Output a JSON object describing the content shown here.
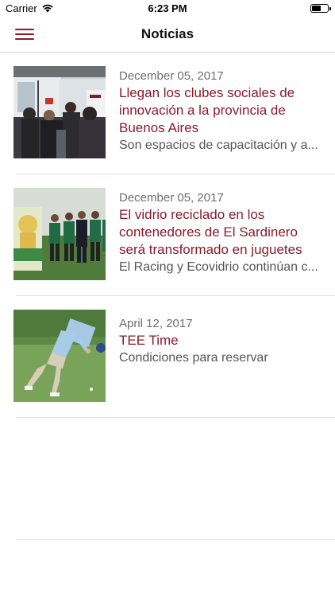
{
  "status_bar": {
    "carrier": "Carrier",
    "time": "6:23 PM",
    "battery_level": 0.6
  },
  "nav": {
    "title": "Noticias",
    "menu_icon": "hamburger-menu-icon",
    "accent_color": "#8b1a2b"
  },
  "news": [
    {
      "date": "December 05, 2017",
      "headline": "Llegan los clubes sociales de innovación a la provincia de Buenos Aires",
      "summary": "Son espacios de capacitación y a..."
    },
    {
      "date": "December 05, 2017",
      "headline": "El vidrio reciclado en los contenedores de El Sardinero será transformado en juguetes",
      "summary": "El Racing y Ecovidrio continúan c..."
    },
    {
      "date": "April 12, 2017",
      "headline": "TEE Time",
      "summary": "Condiciones para reservar"
    }
  ]
}
